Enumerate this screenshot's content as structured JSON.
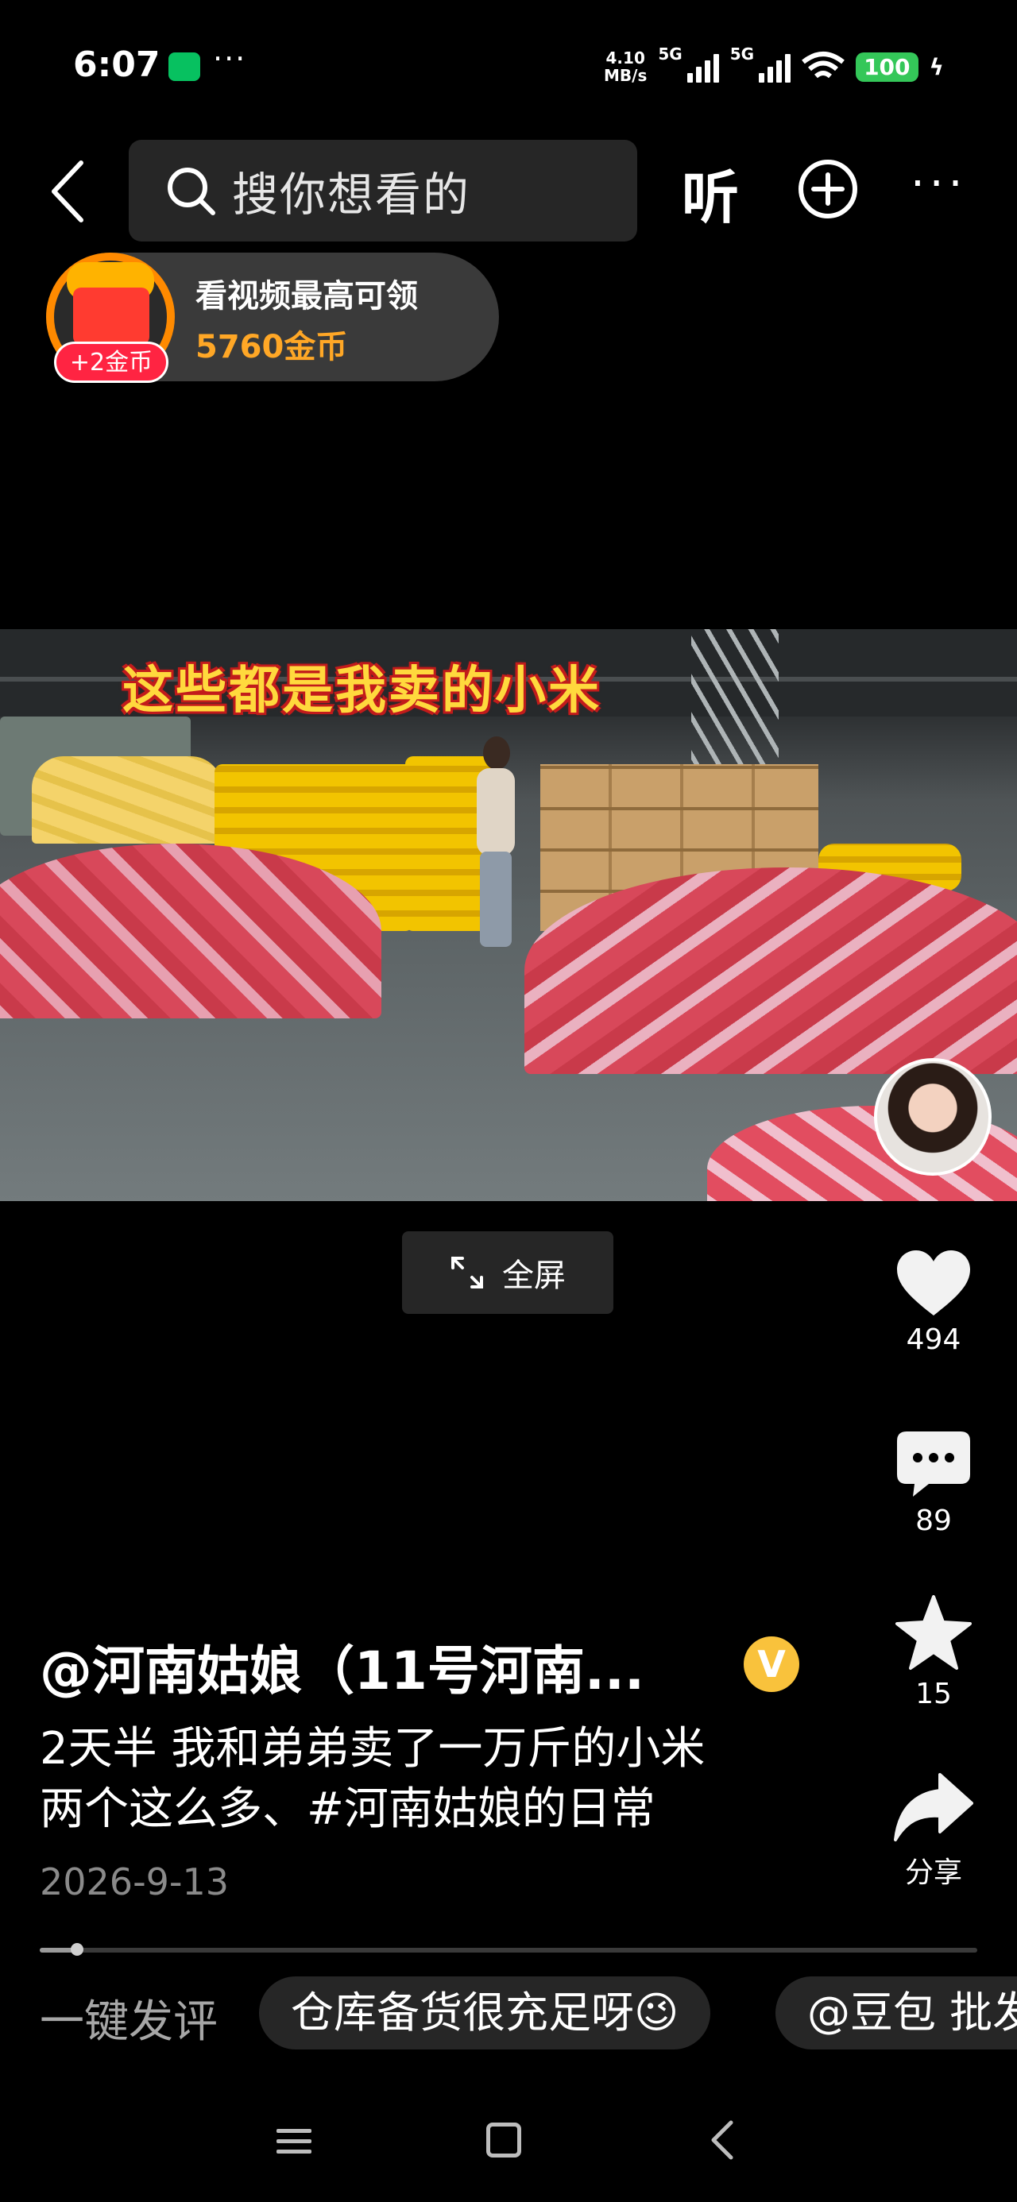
{
  "status_bar": {
    "time": "6:07",
    "speed_value": "4.10",
    "speed_unit": "MB/s",
    "network1": "5G",
    "network2": "5G",
    "battery": "100"
  },
  "header": {
    "search_placeholder": "搜你想看的",
    "listen_label": "听"
  },
  "coin_banner": {
    "badge": "+2金币",
    "title": "看视频最高可领",
    "subtitle": "5760金币"
  },
  "video": {
    "caption": "这些都是我卖的小米",
    "fullscreen_label": "全屏"
  },
  "actions": {
    "likes": "494",
    "comments": "89",
    "favorites": "15",
    "share_label": "分享"
  },
  "post": {
    "author": "@河南姑娘（11号河南...",
    "verified_mark": "V",
    "description_line1": "2天半 我和弟弟卖了一万斤的小米",
    "description_line2": "两个这么多、#河南姑娘的日常",
    "date": "2026-9-13",
    "progress": 0.04
  },
  "quick_comments": {
    "label": "一键发评",
    "chips": [
      "仓库备货很充足呀😉",
      "@豆包 批发"
    ]
  },
  "colors": {
    "accent_orange": "#ffa726",
    "coin_ring": "#ff8a00",
    "badge_red": "#ff2442",
    "verified": "#f9c23c",
    "battery_green": "#34c759"
  }
}
